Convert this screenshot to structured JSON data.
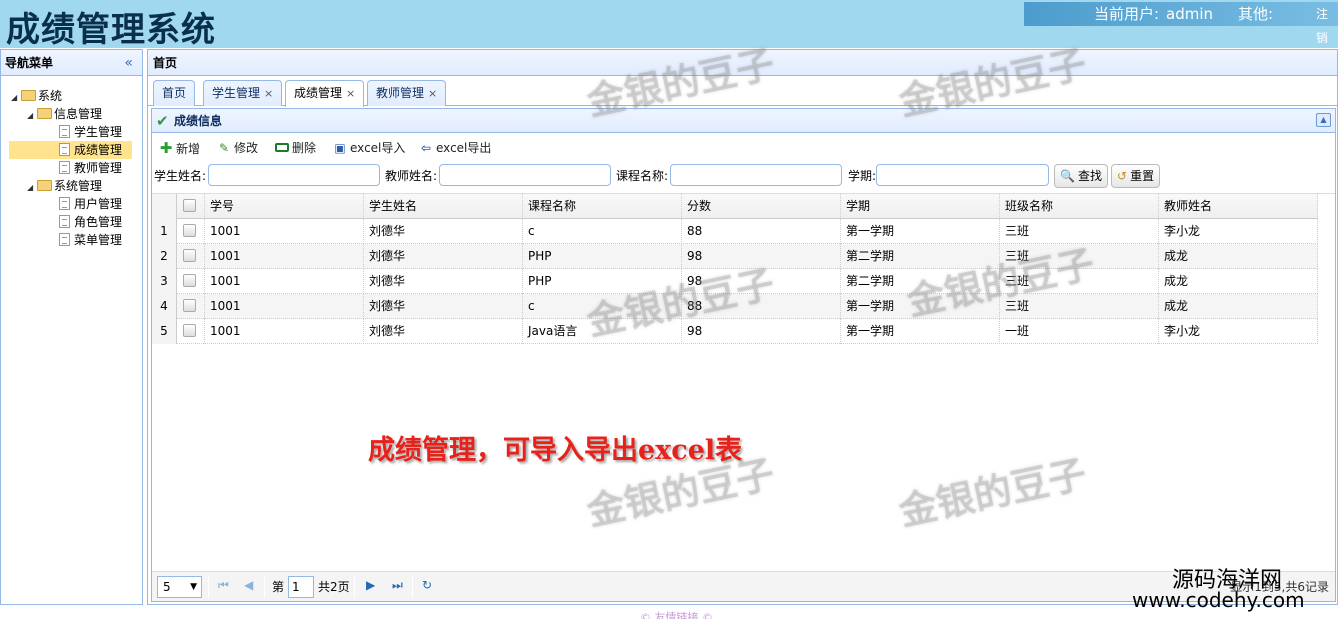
{
  "header": {
    "title": "成绩管理系统",
    "current_user_label": "当前用户:",
    "current_user": "admin",
    "other_label": "其他:",
    "logout_label": "注销"
  },
  "nav": {
    "title": "导航菜单",
    "collapse_icon": "«",
    "tree": {
      "root": "系统",
      "info_group": "信息管理",
      "student_mgmt": "学生管理",
      "score_mgmt": "成绩管理",
      "teacher_mgmt": "教师管理",
      "sys_group": "系统管理",
      "user_mgmt": "用户管理",
      "role_mgmt": "角色管理",
      "menu_mgmt": "菜单管理"
    }
  },
  "main": {
    "title": "首页",
    "tabs": [
      {
        "label": "首页"
      },
      {
        "label": "学生管理",
        "close": "×"
      },
      {
        "label": "成绩管理",
        "close": "×"
      },
      {
        "label": "教师管理",
        "close": "×"
      }
    ],
    "panel_title": "成绩信息"
  },
  "toolbar": {
    "add": "新增",
    "edit": "修改",
    "delete": "删除",
    "import": "excel导入",
    "export": "excel导出"
  },
  "search": {
    "student_name_label": "学生姓名:",
    "teacher_name_label": "教师姓名:",
    "course_name_label": "课程名称:",
    "term_label": "学期:",
    "search_button": "查找",
    "reset_button": "重置"
  },
  "grid": {
    "columns": [
      "学号",
      "学生姓名",
      "课程名称",
      "分数",
      "学期",
      "班级名称",
      "教师姓名"
    ],
    "rows": [
      {
        "rn": "1",
        "cells": [
          "1001",
          "刘德华",
          "c",
          "88",
          "第一学期",
          "三班",
          "李小龙"
        ]
      },
      {
        "rn": "2",
        "cells": [
          "1001",
          "刘德华",
          "PHP",
          "98",
          "第二学期",
          "三班",
          "成龙"
        ]
      },
      {
        "rn": "3",
        "cells": [
          "1001",
          "刘德华",
          "PHP",
          "98",
          "第二学期",
          "三班",
          "成龙"
        ]
      },
      {
        "rn": "4",
        "cells": [
          "1001",
          "刘德华",
          "c",
          "88",
          "第一学期",
          "三班",
          "成龙"
        ]
      },
      {
        "rn": "5",
        "cells": [
          "1001",
          "刘德华",
          "Java语言",
          "98",
          "第一学期",
          "一班",
          "李小龙"
        ]
      }
    ]
  },
  "pager": {
    "page_size": "5",
    "page_prefix": "第",
    "page_number": "1",
    "page_total": "共2页",
    "info": "显示1到5,共6记录"
  },
  "overlay": {
    "watermark": "金银的豆子",
    "annotation": "成绩管理，可导入导出excel表",
    "site_name": "源码海洋网",
    "site_url": "www.codehy.com",
    "footer": "© 友情链接 ©"
  }
}
